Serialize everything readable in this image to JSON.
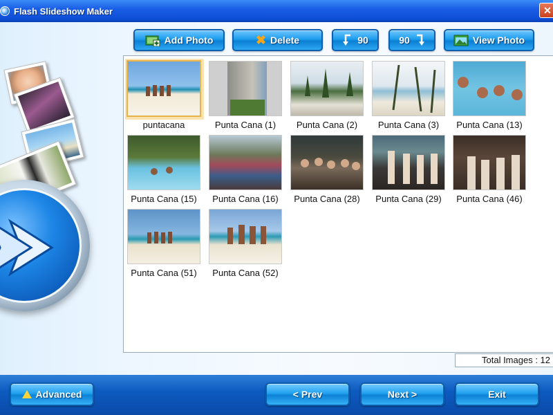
{
  "window": {
    "title": "Flash Slideshow Maker",
    "close_glyph": "✕"
  },
  "toolbar": {
    "add_photo": {
      "label": "Add Photo",
      "icon": "add-photo-icon"
    },
    "delete": {
      "label": "Delete",
      "icon": "delete-x-icon",
      "glyph": "✖"
    },
    "rotate_left": {
      "label": "90",
      "icon": "rotate-left-icon"
    },
    "rotate_right": {
      "label": "90",
      "icon": "rotate-right-icon"
    },
    "view_photo": {
      "label": "View Photo",
      "icon": "view-photo-icon"
    }
  },
  "photos": [
    {
      "caption": "puntacana",
      "selected": true
    },
    {
      "caption": "Punta Cana (1)"
    },
    {
      "caption": "Punta Cana (2)"
    },
    {
      "caption": "Punta Cana (3)"
    },
    {
      "caption": "Punta Cana (13)"
    },
    {
      "caption": "Punta Cana (15)"
    },
    {
      "caption": "Punta Cana (16)"
    },
    {
      "caption": "Punta Cana (28)"
    },
    {
      "caption": "Punta Cana (29)"
    },
    {
      "caption": "Punta Cana (46)"
    },
    {
      "caption": "Punta Cana (51)"
    },
    {
      "caption": "Punta Cana (52)"
    }
  ],
  "status": {
    "text": "Total Images : 12"
  },
  "bottom": {
    "advanced": "Advanced",
    "prev": "< Prev",
    "next": "Next >",
    "exit": "Exit"
  },
  "colors": {
    "title_bar": "#0d4ed6",
    "button": "#1d9ded",
    "selection": "#e8b24a",
    "bottom_bar": "#0d5bc0"
  }
}
